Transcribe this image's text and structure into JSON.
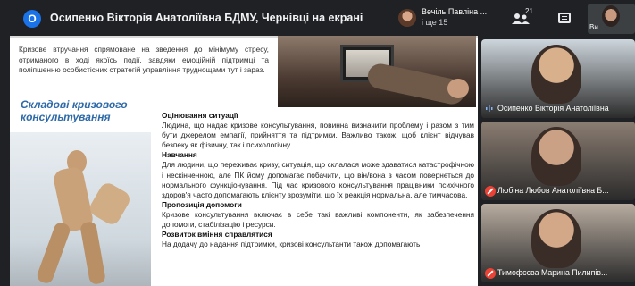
{
  "topbar": {
    "presenter_initial": "О",
    "presenter_title": "Осипенко Вікторія Анатоліївна БДМУ, Чернівці на екрані",
    "speaker_name": "Вечіль Павліна ...",
    "speaker_more": "і ще 15",
    "people_count": "21",
    "self_label": "Ви"
  },
  "slide": {
    "intro": "Кризове втручання спрямоване на зведення до мінімуму стресу, отриманого в ході якоїсь події, завдяки емоційній підтримці та поліпшенню особистісних стратегій управління труднощами тут і зараз.",
    "heading": "Складові кризового консультування",
    "sections": [
      {
        "title": "Оцінювання ситуації",
        "text": "Людина, що надає кризове консультування, повинна визначити проблему і разом з тим бути джерелом емпатії, прийняття та підтримки. Важливо також, щоб клієнт відчував безпеку як фізичну, так і психологічну."
      },
      {
        "title": "Навчання",
        "text": "Для людини, що переживає кризу, ситуація, що склалася може здаватися катастрофічною і нескінченною, але ПК йому допомагає побачити, що він/вона з часом повернеться до нормального функціонування. Під час кризового консультування працівники психічного здоров'я часто допомагають клієнту зрозуміти, що їх реакція нормальна, але тимчасова."
      },
      {
        "title": "Пропозиція допомоги",
        "text": "Кризове консультування включає в себе такі важливі компоненти, як забезпечення допомоги, стабілізацію і ресурси."
      },
      {
        "title": "Розвиток вміння справлятися",
        "text": "На додачу до надання підтримки, кризові консультанти також допомагають"
      }
    ]
  },
  "participants": [
    {
      "name": "Осипенко Вікторія Анатоліївна",
      "mic": "on",
      "bg": "#cdd6dc",
      "skin": "#d9b08c"
    },
    {
      "name": "Любіна Любов Анатоліївна Б...",
      "mic": "off",
      "bg": "#8b7d72",
      "skin": "#caa184"
    },
    {
      "name": "Тимофєєва Марина Пилипів...",
      "mic": "off",
      "bg": "#b8aca0",
      "skin": "#d2a889"
    }
  ]
}
